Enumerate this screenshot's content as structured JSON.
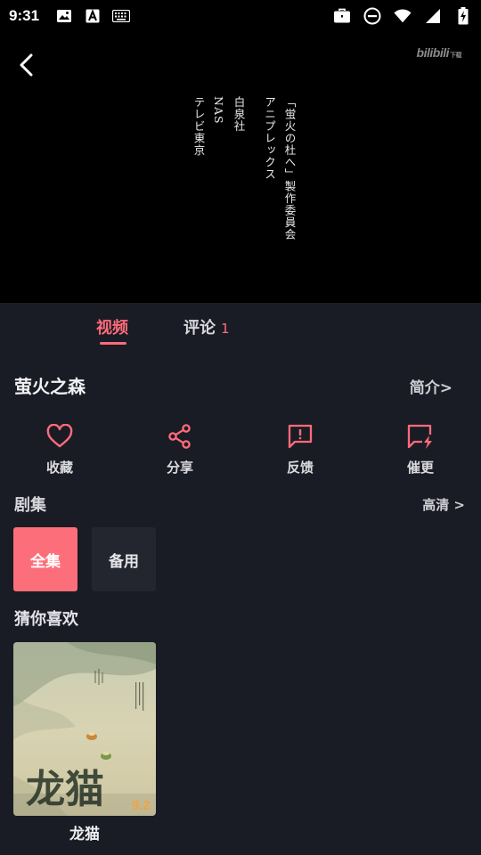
{
  "status_bar": {
    "time": "9:31",
    "left_icons": [
      "image-icon",
      "text-a-icon",
      "keyboard-icon"
    ],
    "right_icons": [
      "work-briefcase-icon",
      "do-not-disturb-icon",
      "wifi-icon",
      "signal-icon",
      "battery-charging-icon"
    ]
  },
  "video": {
    "watermark": "bilibili",
    "watermark_small": "下载",
    "credits": [
      "「蛍火の杜へ」製作委員会",
      "アニプレックス",
      "白泉社",
      "NAS",
      "テレビ東京"
    ]
  },
  "tabs": [
    {
      "label": "视频",
      "active": true
    },
    {
      "label": "评论",
      "count": "1",
      "active": false
    }
  ],
  "title": "萤火之森",
  "intro_link": "简介>",
  "actions": [
    {
      "label": "收藏",
      "icon": "heart-icon"
    },
    {
      "label": "分享",
      "icon": "share-icon"
    },
    {
      "label": "反馈",
      "icon": "feedback-icon"
    },
    {
      "label": "催更",
      "icon": "remind-update-icon"
    }
  ],
  "episodes": {
    "label": "剧集",
    "quality_link": "高清 >",
    "buttons": [
      "全集",
      "备用"
    ]
  },
  "recommend": {
    "label": "猜你喜欢",
    "items": [
      {
        "title": "龙猫",
        "rating": "9.2",
        "poster_text": "龙猫"
      }
    ]
  },
  "colors": {
    "accent": "#ff6b7a",
    "background": "#1a1c25",
    "rating": "#f3a33f"
  }
}
